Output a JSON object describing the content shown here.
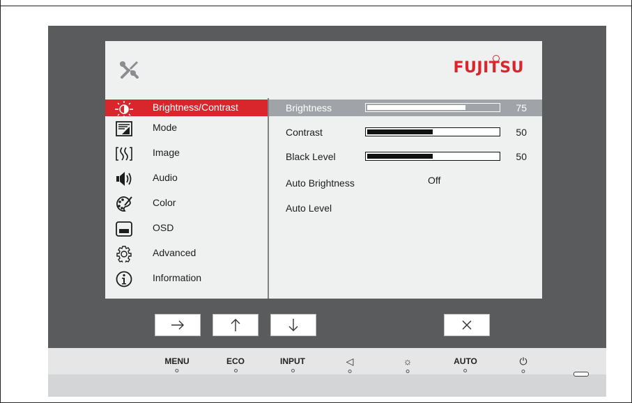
{
  "brand": "FUJITSU",
  "menu": {
    "items": [
      {
        "label": "Brightness/Contrast",
        "icon": "brightness-icon",
        "selected": true
      },
      {
        "label": "Mode",
        "icon": "mode-icon",
        "selected": false
      },
      {
        "label": "Image",
        "icon": "image-icon",
        "selected": false
      },
      {
        "label": "Audio",
        "icon": "speaker-icon",
        "selected": false
      },
      {
        "label": "Color",
        "icon": "palette-icon",
        "selected": false
      },
      {
        "label": "OSD",
        "icon": "osd-icon",
        "selected": false
      },
      {
        "label": "Advanced",
        "icon": "gear-icon",
        "selected": false
      },
      {
        "label": "Information",
        "icon": "info-icon",
        "selected": false
      }
    ]
  },
  "settings": {
    "brightness": {
      "label": "Brightness",
      "value": "75",
      "level": 0.75
    },
    "contrast": {
      "label": "Contrast",
      "value": "50",
      "level": 0.5
    },
    "black_level": {
      "label": "Black Level",
      "value": "50",
      "level": 0.5
    },
    "auto_brightness": {
      "label": "Auto Brightness",
      "value": "Off"
    },
    "auto_level": {
      "label": "Auto Level"
    }
  },
  "nav_buttons": [
    "→",
    "↑",
    "↓",
    "×"
  ],
  "base_buttons": {
    "menu": "MENU",
    "eco": "ECO",
    "input": "INPUT",
    "volume": "◁",
    "brightness": "☼",
    "auto": "AUTO",
    "power": "⏻"
  },
  "colors": {
    "accent": "#d9262c",
    "bezel": "#595b5d",
    "osd_bg": "#eff0f0",
    "selected_setting": "#a0a3a7"
  }
}
